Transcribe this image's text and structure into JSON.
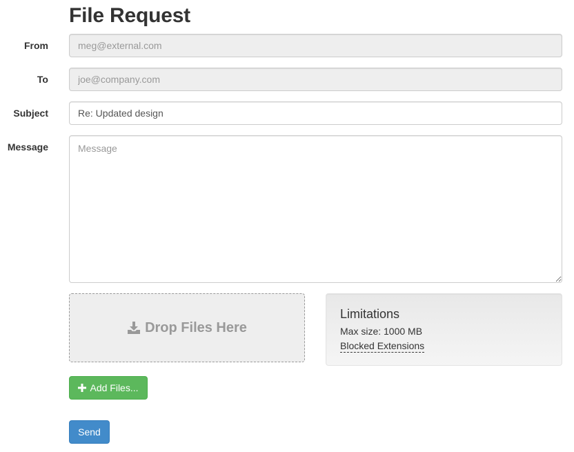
{
  "page": {
    "title": "File Request"
  },
  "form": {
    "from": {
      "label": "From",
      "placeholder": "meg@external.com",
      "value": ""
    },
    "to": {
      "label": "To",
      "placeholder": "joe@company.com",
      "value": ""
    },
    "subject": {
      "label": "Subject",
      "value": "Re: Updated design"
    },
    "message": {
      "label": "Message",
      "placeholder": "Message",
      "value": ""
    }
  },
  "dropzone": {
    "label": "Drop Files Here",
    "icon": "download-icon"
  },
  "limitations": {
    "title": "Limitations",
    "max_size": "Max size: 1000 MB",
    "blocked_extensions": "Blocked Extensions"
  },
  "actions": {
    "add_files": "Add Files...",
    "add_files_icon": "plus-icon",
    "send": "Send"
  },
  "colors": {
    "success": "#5cb85c",
    "primary": "#428bca",
    "disabled_bg": "#eeeeee"
  }
}
